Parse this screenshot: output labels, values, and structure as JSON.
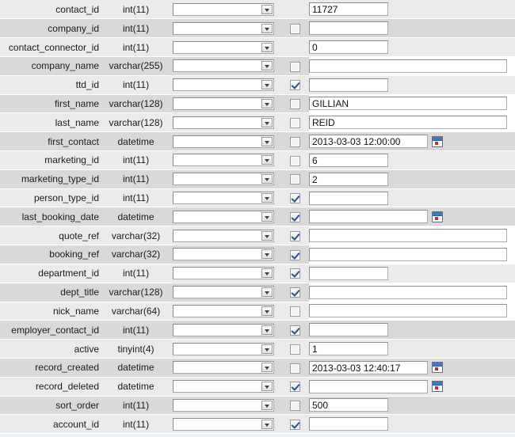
{
  "table": {
    "columns": [
      "field_name",
      "data_type",
      "operator_select",
      "null_checkbox",
      "value_input"
    ],
    "rows": [
      {
        "name": "contact_id",
        "type": "int(11)",
        "has_checkbox": false,
        "checked": false,
        "value": "11727",
        "input": "narrow",
        "calendar": false
      },
      {
        "name": "company_id",
        "type": "int(11)",
        "has_checkbox": true,
        "checked": false,
        "value": "",
        "input": "narrow",
        "calendar": false
      },
      {
        "name": "contact_connector_id",
        "type": "int(11)",
        "has_checkbox": false,
        "checked": false,
        "value": "0",
        "input": "narrow",
        "calendar": false
      },
      {
        "name": "company_name",
        "type": "varchar(255)",
        "has_checkbox": true,
        "checked": false,
        "value": "",
        "input": "wide",
        "calendar": false
      },
      {
        "name": "ttd_id",
        "type": "int(11)",
        "has_checkbox": true,
        "checked": true,
        "value": "",
        "input": "narrow",
        "calendar": false
      },
      {
        "name": "first_name",
        "type": "varchar(128)",
        "has_checkbox": true,
        "checked": false,
        "value": "GILLIAN",
        "input": "wide",
        "calendar": false
      },
      {
        "name": "last_name",
        "type": "varchar(128)",
        "has_checkbox": true,
        "checked": false,
        "value": "REID",
        "input": "wide",
        "calendar": false
      },
      {
        "name": "first_contact",
        "type": "datetime",
        "has_checkbox": true,
        "checked": false,
        "value": "2013-03-03 12:00:00",
        "input": "dt",
        "calendar": true
      },
      {
        "name": "marketing_id",
        "type": "int(11)",
        "has_checkbox": true,
        "checked": false,
        "value": "6",
        "input": "narrow",
        "calendar": false
      },
      {
        "name": "marketing_type_id",
        "type": "int(11)",
        "has_checkbox": true,
        "checked": false,
        "value": "2",
        "input": "narrow",
        "calendar": false
      },
      {
        "name": "person_type_id",
        "type": "int(11)",
        "has_checkbox": true,
        "checked": true,
        "value": "",
        "input": "narrow",
        "calendar": false
      },
      {
        "name": "last_booking_date",
        "type": "datetime",
        "has_checkbox": true,
        "checked": true,
        "value": "",
        "input": "dt",
        "calendar": true
      },
      {
        "name": "quote_ref",
        "type": "varchar(32)",
        "has_checkbox": true,
        "checked": true,
        "value": "",
        "input": "wide",
        "calendar": false
      },
      {
        "name": "booking_ref",
        "type": "varchar(32)",
        "has_checkbox": true,
        "checked": true,
        "value": "",
        "input": "wide",
        "calendar": false
      },
      {
        "name": "department_id",
        "type": "int(11)",
        "has_checkbox": true,
        "checked": true,
        "value": "",
        "input": "narrow",
        "calendar": false
      },
      {
        "name": "dept_title",
        "type": "varchar(128)",
        "has_checkbox": true,
        "checked": true,
        "value": "",
        "input": "wide",
        "calendar": false
      },
      {
        "name": "nick_name",
        "type": "varchar(64)",
        "has_checkbox": true,
        "checked": false,
        "value": "",
        "input": "wide",
        "calendar": false
      },
      {
        "name": "employer_contact_id",
        "type": "int(11)",
        "has_checkbox": true,
        "checked": true,
        "value": "",
        "input": "narrow",
        "calendar": false
      },
      {
        "name": "active",
        "type": "tinyint(4)",
        "has_checkbox": true,
        "checked": false,
        "value": "1",
        "input": "narrow",
        "calendar": false
      },
      {
        "name": "record_created",
        "type": "datetime",
        "has_checkbox": true,
        "checked": false,
        "value": "2013-03-03 12:40:17",
        "input": "dt",
        "calendar": true
      },
      {
        "name": "record_deleted",
        "type": "datetime",
        "has_checkbox": true,
        "checked": true,
        "value": "",
        "input": "dt",
        "calendar": true
      },
      {
        "name": "sort_order",
        "type": "int(11)",
        "has_checkbox": true,
        "checked": false,
        "value": "500",
        "input": "narrow",
        "calendar": false
      },
      {
        "name": "account_id",
        "type": "int(11)",
        "has_checkbox": true,
        "checked": true,
        "value": "",
        "input": "narrow",
        "calendar": false
      }
    ]
  },
  "icons": {
    "dropdown": "chevron-down-icon",
    "calendar": "calendar-icon",
    "checkbox": "checkbox-icon"
  },
  "colors": {
    "row_odd": "#ebebeb",
    "row_even": "#d9d9d9",
    "input_bg": "#ffffff",
    "check_mark": "#2d4f8e",
    "calendar_header": "#3f78c8",
    "calendar_dot": "#c03030"
  }
}
